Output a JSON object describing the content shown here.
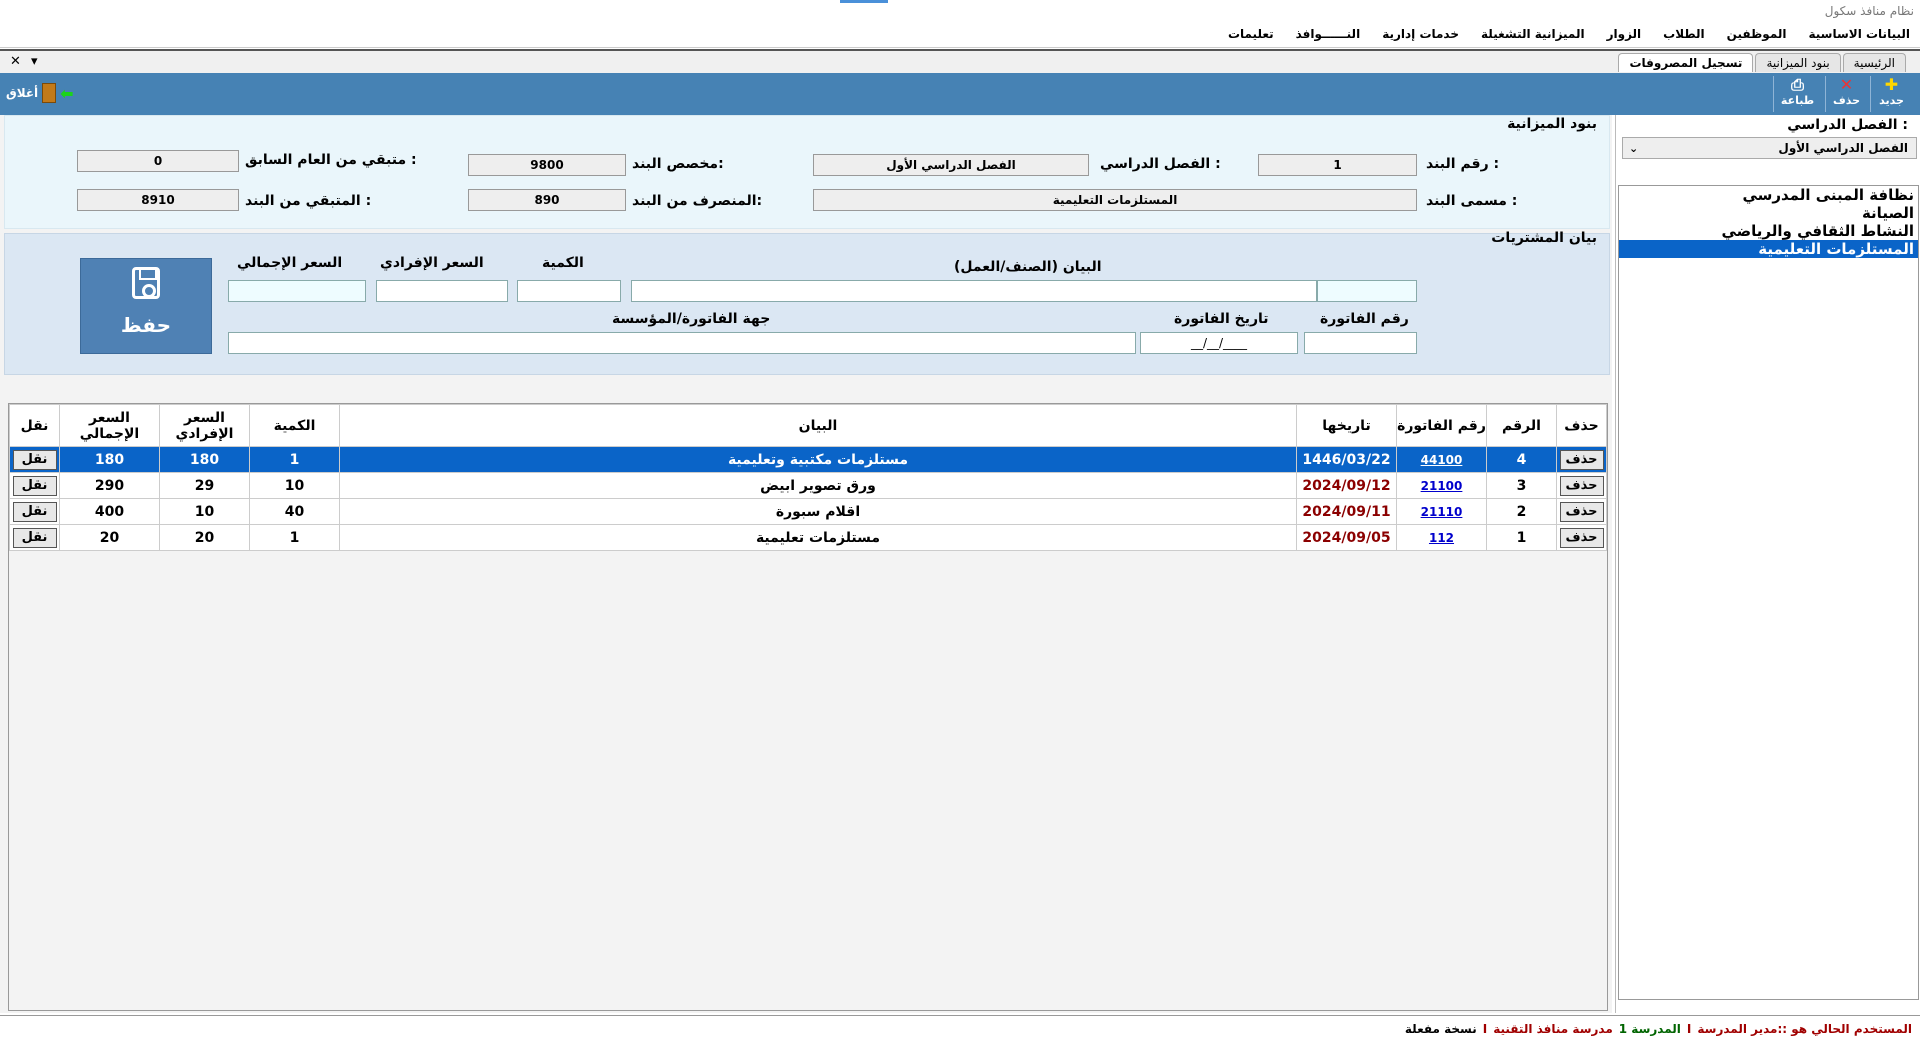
{
  "window": {
    "title": "نظام منافذ سكول"
  },
  "menu": [
    "البيانات الاساسية",
    "الموظفين",
    "الطلاب",
    "الزوار",
    "الميزانية التشغيلة",
    "خدمات إدارية",
    "النــــــوافذ",
    "تعليمات"
  ],
  "tabs": [
    {
      "label": "الرئيسية",
      "active": false
    },
    {
      "label": "بنود الميزانية",
      "active": false
    },
    {
      "label": "تسجيل المصروفات",
      "active": true
    }
  ],
  "tab_controls": {
    "close": "✕",
    "menu": "▾"
  },
  "toolbar": {
    "new": "جديد",
    "delete": "حذف",
    "print": "طباعة",
    "close": "أغلاق"
  },
  "sidebar": {
    "semester_label": "الفصل الدراسي :",
    "semester_value": "الفصل الدراسي الأول",
    "items": [
      "نظافة المبنى المدرسي",
      "الصيانة",
      "النشاط الثقافي والرياضي",
      "المستلزمات التعليمية"
    ],
    "selected_index": 3
  },
  "budget": {
    "section_title": "بنود الميزانية",
    "item_no_label": "رقم البند :",
    "item_no": "1",
    "semester_label": "الفصل الدراسي :",
    "semester": "الفصل الدراسي الأول",
    "allocated_label": "مخصص البند:",
    "allocated": "9800",
    "prev_year_label": "متبقي من العام السابق :",
    "prev_year": "0",
    "item_name_label": "مسمى البند :",
    "item_name": "المستلزمات التعليمية",
    "spent_label": "المنصرف من البند:",
    "spent": "890",
    "remaining_label": "المتبقي من البند :",
    "remaining": "8910"
  },
  "purchase": {
    "section_title": "بيان المشتريات",
    "desc_label": "البيان (الصنف/العمل)",
    "qty_label": "الكمية",
    "unit_price_label": "السعر الإفرادي",
    "total_label": "السعر الإجمالي",
    "invoice_no_label": "رقم الفاتورة",
    "invoice_date_label": "تاريخ الفاتورة",
    "invoice_date_placeholder": "__/__/____",
    "vendor_label": "جهة الفاتورة/المؤسسة",
    "save_label": "حفظ"
  },
  "table": {
    "headers": {
      "delete": "حذف",
      "no": "الرقم",
      "invoice": "رقم الفاتورة",
      "date": "تاريخها",
      "desc": "البيان",
      "qty": "الكمية",
      "unit": "السعر الإفرادي",
      "total": "السعر الإجمالي",
      "move": "نقل"
    },
    "rows": [
      {
        "delete": "حذف",
        "no": "4",
        "invoice": "44100",
        "date": "1446/03/22",
        "desc": "مستلزمات مكتبية وتعليمية",
        "qty": "1",
        "unit": "180",
        "total": "180",
        "move": "نقل",
        "selected": true
      },
      {
        "delete": "حذف",
        "no": "3",
        "invoice": "21100",
        "date": "2024/09/12",
        "desc": "ورق تصوير ابيض",
        "qty": "10",
        "unit": "29",
        "total": "290",
        "move": "نقل",
        "selected": false
      },
      {
        "delete": "حذف",
        "no": "2",
        "invoice": "21110",
        "date": "2024/09/11",
        "desc": "اقلام سبورة",
        "qty": "40",
        "unit": "10",
        "total": "400",
        "move": "نقل",
        "selected": false
      },
      {
        "delete": "حذف",
        "no": "1",
        "invoice": "112",
        "date": "2024/09/05",
        "desc": "مستلزمات تعليمية",
        "qty": "1",
        "unit": "20",
        "total": "20",
        "move": "نقل",
        "selected": false
      }
    ]
  },
  "status": {
    "user": "المستخدم الحالي هو ::مدير المدرسة",
    "sep1": "I",
    "school_label": "1 المدرسة",
    "school": "مدرسة منافذ التقنية",
    "sep2": "I",
    "version": "نسخة مفعلة"
  },
  "colors": {
    "toolbar": "#4682b4",
    "selection": "#0a64c8",
    "budget_panel": "#eaf6fb",
    "purchase_panel": "#dbe7f3",
    "date_red": "#8b0000",
    "status_red": "#a00000"
  }
}
